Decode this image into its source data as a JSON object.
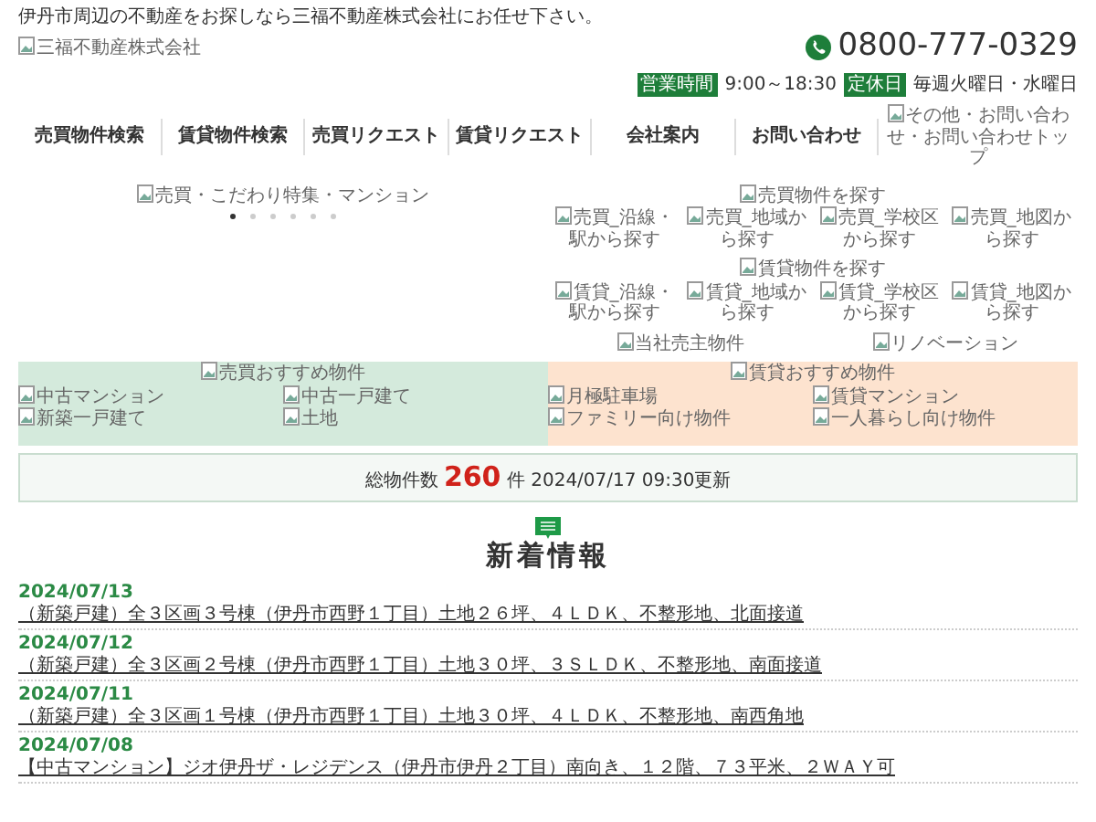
{
  "tagline": "伊丹市周辺の不動産をお探しなら三福不動産株式会社にお任せ下さい。",
  "logo_alt": "三福不動産株式会社",
  "phone": "0800-777-0329",
  "hours": [
    {
      "label": "営業時間",
      "value": "9:00～18:30"
    },
    {
      "label": "定休日",
      "value": "毎週火曜日・水曜日"
    }
  ],
  "nav": [
    "売買物件検索",
    "賃貸物件検索",
    "売買リクエスト",
    "賃貸リクエスト",
    "会社案内",
    "お問い合わせ"
  ],
  "nav_image_alt": "その他・お問い合わせ・お問い合わせトップ",
  "slider": {
    "alt": "売買・こだわり特集・マンション",
    "dots": [
      {
        "selected": true
      },
      {
        "selected": false
      },
      {
        "selected": false
      },
      {
        "selected": false
      },
      {
        "selected": false
      },
      {
        "selected": false
      }
    ]
  },
  "search_groups": [
    {
      "title": "売買物件を探す",
      "items": [
        "売買_沿線・駅から探す",
        "売買_地域から探す",
        "売買_学校区から探す",
        "売買_地図から探す"
      ]
    },
    {
      "title": "賃貸物件を探す",
      "items": [
        "賃貸_沿線・駅から探す",
        "賃貸_地域から探す",
        "賃貸_学校区から探す",
        "賃貸_地図から探す"
      ]
    }
  ],
  "extra_links": [
    "当社売主物件",
    "リノベーション"
  ],
  "recommend": [
    {
      "kind": "sale",
      "title": "売買おすすめ物件",
      "items": [
        "中古マンション",
        "中古一戸建て",
        "新築一戸建て",
        "土地"
      ]
    },
    {
      "kind": "rent",
      "title": "賃貸おすすめ物件",
      "items": [
        "月極駐車場",
        "賃貸マンション",
        "ファミリー向け物件",
        "一人暮らし向け物件"
      ]
    }
  ],
  "count": {
    "label": "総物件数",
    "value": "260",
    "unit": "件",
    "updated": "2024/07/17 09:30更新"
  },
  "news": {
    "title": "新着情報",
    "items": [
      {
        "date": "2024/07/13",
        "text": "（新築戸建）全３区画３号棟（伊丹市西野１丁目）土地２６坪、４ＬＤＫ、不整形地、北面接道"
      },
      {
        "date": "2024/07/12",
        "text": "（新築戸建）全３区画２号棟（伊丹市西野１丁目）土地３０坪、３ＳＬＤＫ、不整形地、南面接道"
      },
      {
        "date": "2024/07/11",
        "text": "（新築戸建）全３区画１号棟（伊丹市西野１丁目）土地３０坪、４ＬＤＫ、不整形地、南西角地"
      },
      {
        "date": "2024/07/08",
        "text": "【中古マンション】ジオ伊丹ザ・レジデンス（伊丹市伊丹２丁目）南向き、１２階、７３平米、２ＷＡＹ可"
      }
    ]
  }
}
